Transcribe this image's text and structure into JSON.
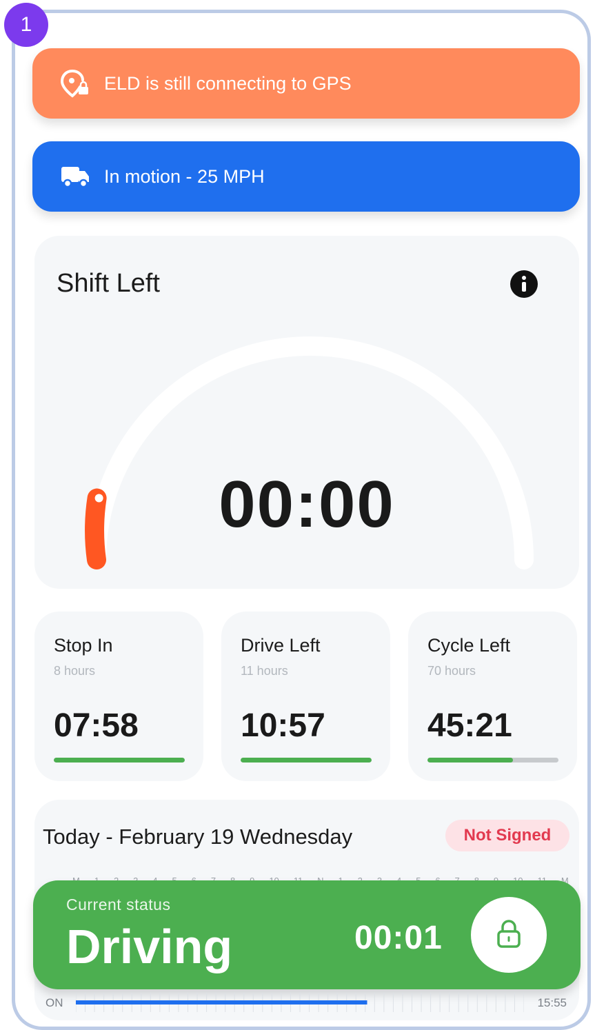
{
  "step_badge": "1",
  "banners": {
    "gps": {
      "text": "ELD is still connecting to GPS",
      "icon": "location-lock-icon",
      "color": "#ff8a5c"
    },
    "motion": {
      "text": "In motion - 25 MPH",
      "icon": "truck-icon",
      "color": "#1f6fee"
    }
  },
  "shift": {
    "title": "Shift Left",
    "time": "00:00",
    "progress": 0.02,
    "info_icon": "info-icon",
    "indicator_color": "#ff5722"
  },
  "stats": [
    {
      "title": "Stop In",
      "subtitle": "8 hours",
      "value": "07:58",
      "progress": 1.0
    },
    {
      "title": "Drive Left",
      "subtitle": "11 hours",
      "value": "10:57",
      "progress": 1.0
    },
    {
      "title": "Cycle Left",
      "subtitle": "70 hours",
      "value": "45:21",
      "progress": 0.65
    }
  ],
  "log": {
    "title": "Today - February 19 Wednesday",
    "signed_badge": "Not Signed",
    "hour_labels": [
      "M",
      "1",
      "2",
      "3",
      "4",
      "5",
      "6",
      "7",
      "8",
      "9",
      "10",
      "11",
      "N",
      "1",
      "2",
      "3",
      "4",
      "5",
      "6",
      "7",
      "8",
      "9",
      "10",
      "11",
      "M"
    ]
  },
  "current_status": {
    "label": "Current status",
    "value": "Driving",
    "timer": "00:01",
    "lock_icon": "lock-icon",
    "color": "#4caf50"
  },
  "timeline": {
    "row_label": "ON",
    "end_time": "15:55",
    "progress": 0.65
  }
}
